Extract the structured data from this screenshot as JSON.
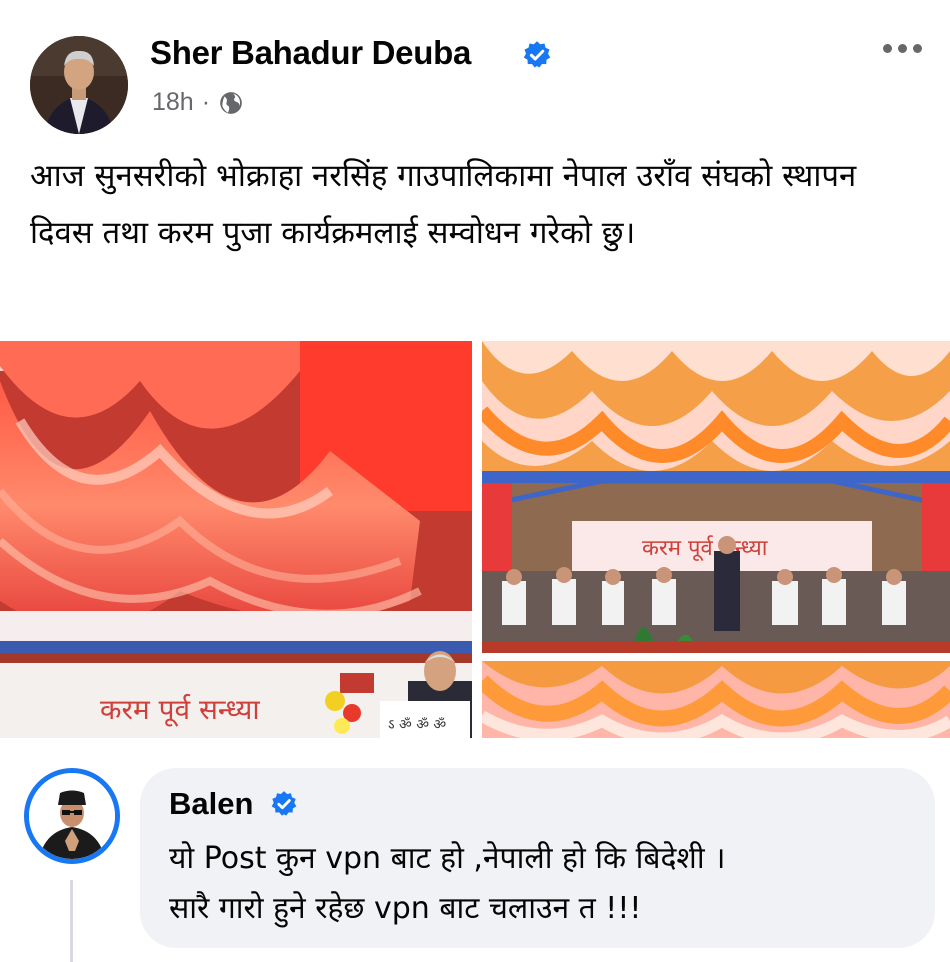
{
  "post": {
    "author_name": "Sher Bahadur Deuba",
    "verified": true,
    "time": "18h",
    "separator": "·",
    "audience_icon": "globe-icon",
    "more_icon": "more-horizontal-icon",
    "text": "आज सुनसरीको भोक्राहा नरसिंह गाउपालिकामा नेपाल उराँव संघको स्थापन दिवस तथा करम पुजा कार्यक्रमलाई सम्वोधन गरेको छु।",
    "photos": [
      {
        "id": "photo-1",
        "banner_text": "करम पूर्व सन्ध्या"
      },
      {
        "id": "photo-2",
        "banner_text": "करम पूर्व सन्ध्या"
      },
      {
        "id": "photo-3"
      }
    ]
  },
  "comment": {
    "author_name": "Balen",
    "verified": true,
    "line1": "यो Post कुन vpn बाट हो ,नेपाली हो कि बिदेशी ।",
    "line2": "सारै गारो हुने रहेछ vpn बाट चलाउन त !!!"
  },
  "colors": {
    "verified_blue": "#1877f2",
    "meta_gray": "#65676b",
    "bubble_bg": "#f0f2f5"
  }
}
